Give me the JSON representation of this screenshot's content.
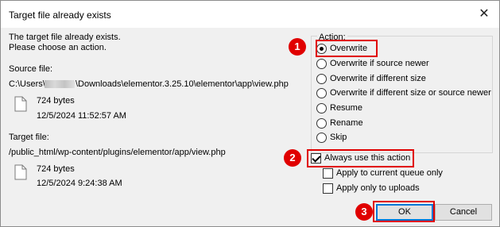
{
  "window": {
    "title": "Target file already exists",
    "close_glyph": "✕"
  },
  "message": {
    "line1": "The target file already exists.",
    "line2": "Please choose an action."
  },
  "source": {
    "label": "Source file:",
    "path_prefix": "C:\\Users\\",
    "path_suffix": "\\Downloads\\elementor.3.25.10\\elementor\\app\\view.php",
    "size": "724 bytes",
    "date": "12/5/2024 11:52:57 AM"
  },
  "target": {
    "label": "Target file:",
    "path": "/public_html/wp-content/plugins/elementor/app/view.php",
    "size": "724 bytes",
    "date": "12/5/2024 9:24:38 AM"
  },
  "action": {
    "legend": "Action:",
    "options": [
      {
        "label": "Overwrite",
        "checked": true
      },
      {
        "label": "Overwrite if source newer",
        "checked": false
      },
      {
        "label": "Overwrite if different size",
        "checked": false
      },
      {
        "label": "Overwrite if different size or source newer",
        "checked": false
      },
      {
        "label": "Resume",
        "checked": false
      },
      {
        "label": "Rename",
        "checked": false
      },
      {
        "label": "Skip",
        "checked": false
      }
    ]
  },
  "checkboxes": {
    "always_use": {
      "label": "Always use this action",
      "checked": true
    },
    "current_queue": {
      "label": "Apply to current queue only",
      "checked": false
    },
    "uploads_only": {
      "label": "Apply only to uploads",
      "checked": false
    }
  },
  "buttons": {
    "ok": "OK",
    "cancel": "Cancel"
  },
  "annotations": {
    "step1": "1",
    "step2": "2",
    "step3": "3",
    "color": "#e00000"
  },
  "colors": {
    "default_button_border": "#0078d7",
    "panel_bg": "#f0f0f0"
  }
}
